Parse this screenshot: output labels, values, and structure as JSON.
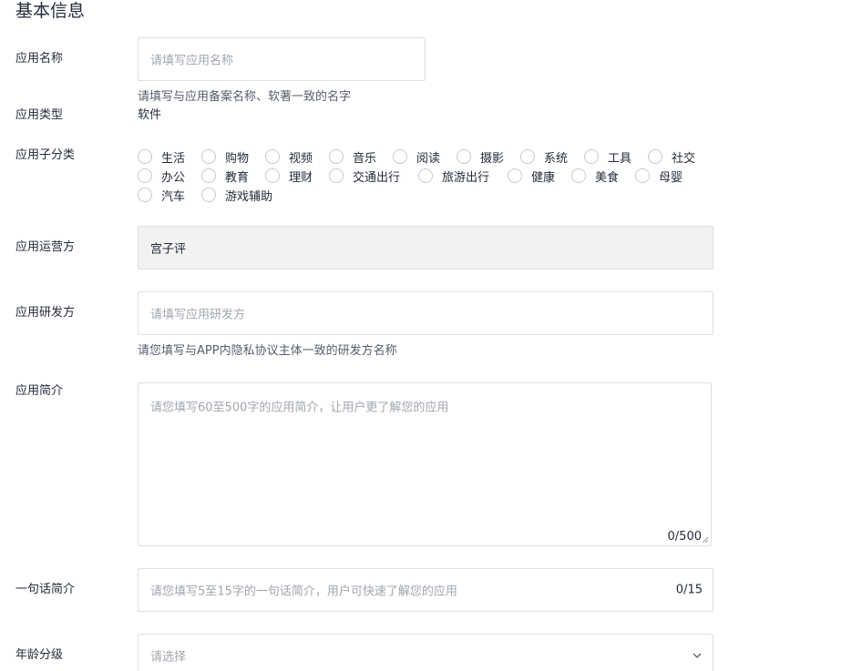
{
  "section_title": "基本信息",
  "fields": {
    "app_name": {
      "label": "应用名称",
      "placeholder": "请填写应用名称",
      "help": "请填写与应用备案名称、软著一致的名字"
    },
    "app_type": {
      "label": "应用类型",
      "value": "软件"
    },
    "app_subcategory": {
      "label": "应用子分类",
      "options_row1": [
        "生活",
        "购物",
        "视频",
        "音乐",
        "阅读",
        "摄影",
        "系统",
        "工具",
        "社交"
      ],
      "options_row2": [
        "办公",
        "教育",
        "理财",
        "交通出行",
        "旅游出行",
        "健康",
        "美食",
        "母婴"
      ],
      "options_row3": [
        "汽车",
        "游戏辅助"
      ]
    },
    "operator": {
      "label": "应用运营方",
      "value": "宫子评"
    },
    "developer": {
      "label": "应用研发方",
      "placeholder": "请填写应用研发方",
      "help": "请您填写与APP内隐私协议主体一致的研发方名称"
    },
    "intro": {
      "label": "应用简介",
      "placeholder": "请您填写60至500字的应用简介，让用户更了解您的应用",
      "counter": "0/500"
    },
    "slogan": {
      "label": "一句话简介",
      "placeholder": "请您填写5至15字的一句话简介，用户可快速了解您的应用",
      "counter": "0/15"
    },
    "age_rating": {
      "label": "年龄分级",
      "placeholder": "请选择"
    }
  }
}
